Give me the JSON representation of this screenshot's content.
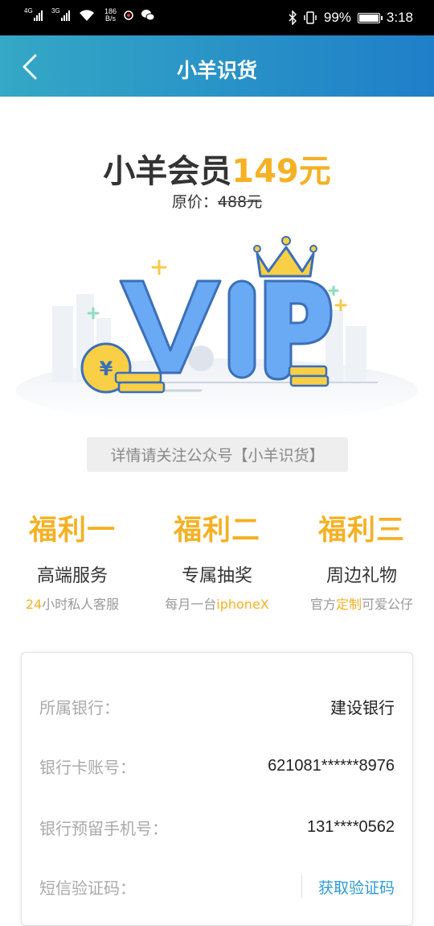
{
  "status_bar": {
    "sim1": "4G",
    "sim2": "3G",
    "speed_value": "186",
    "speed_unit": "B/s",
    "battery": "99%",
    "time": "3:18",
    "battery_level": 0.99
  },
  "nav": {
    "title": "小羊识货"
  },
  "membership": {
    "title_prefix": "小羊会员",
    "price": "149元",
    "original_label": "原价：",
    "original_price": "488元"
  },
  "notice": "详情请关注公众号【小羊识货】",
  "benefits": [
    {
      "title": "福利一",
      "subtitle": "高端服务",
      "desc_highlight": "24",
      "desc_rest": "小时私人客服"
    },
    {
      "title": "福利二",
      "subtitle": "专属抽奖",
      "desc_pre": "每月一台",
      "desc_highlight": "iphoneX"
    },
    {
      "title": "福利三",
      "subtitle": "周边礼物",
      "desc_pre": "官方",
      "desc_highlight": "定制",
      "desc_rest": "可爱公仔"
    }
  ],
  "form": {
    "bank_label": "所属银行：",
    "bank_value": "建设银行",
    "card_label": "银行卡账号：",
    "card_value": "621081******8976",
    "phone_label": "银行预留手机号：",
    "phone_value": "131****0562",
    "sms_label": "短信验证码：",
    "sms_button": "获取验证码"
  },
  "colors": {
    "accent": "#f5b124",
    "nav_start": "#34a8c6",
    "nav_end": "#1f7fc8",
    "link": "#2d9ad6"
  }
}
